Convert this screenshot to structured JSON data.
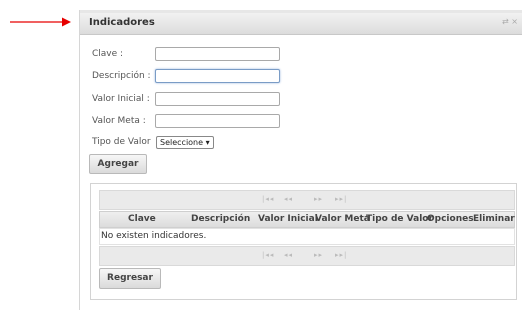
{
  "panel": {
    "title": "Indicadores",
    "header_icons": "⇄ ×"
  },
  "form": {
    "clave_label": "Clave :",
    "descripcion_label": "Descripción :",
    "valor_inicial_label": "Valor Inicial :",
    "valor_meta_label": "Valor Meta :",
    "tipo_valor_label": "Tipo de Valor",
    "tipo_valor_selected": "Seleccione ▾",
    "agregar_label": "Agregar"
  },
  "grid": {
    "pager": {
      "first": "|◂◂",
      "prev": "◂◂",
      "next": "▸▸",
      "last": "▸▸|"
    },
    "columns": [
      "Clave",
      "Descripción",
      "Valor Inicial",
      "Valor Meta",
      "Tipo de Valor",
      "Opciones",
      "Eliminar"
    ],
    "empty_message": "No existen indicadores."
  },
  "footer": {
    "regresar_label": "Regresar"
  },
  "colors": {
    "annotation_arrow": "#e60000",
    "header_bg": "#dcdcdc"
  }
}
